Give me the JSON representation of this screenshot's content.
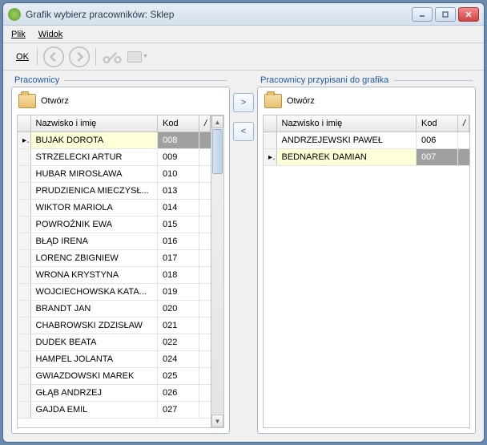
{
  "window": {
    "title": "Grafik wybierz pracowników: Sklep"
  },
  "menu": {
    "file": "Plik",
    "view": "Widok"
  },
  "toolbar": {
    "ok_label": "OK"
  },
  "left_panel": {
    "legend": "Pracownicy",
    "open_label": "Otwórz",
    "columns": {
      "name": "Nazwisko i imię",
      "code": "Kod",
      "mark": "/"
    },
    "rows": [
      {
        "name": "BUJAK DOROTA",
        "code": "008",
        "selected": true
      },
      {
        "name": "STRZELECKI ARTUR",
        "code": "009"
      },
      {
        "name": "HUBAR MIROSŁAWA",
        "code": "010"
      },
      {
        "name": "PRUDZIENICA MIECZYSŁ...",
        "code": "013"
      },
      {
        "name": "WIKTOR MARIOLA",
        "code": "014"
      },
      {
        "name": "POWROŹNIK EWA",
        "code": "015"
      },
      {
        "name": "BŁĄD IRENA",
        "code": "016"
      },
      {
        "name": "LORENC ZBIGNIEW",
        "code": "017"
      },
      {
        "name": "WRONA KRYSTYNA",
        "code": "018"
      },
      {
        "name": "WOJCIECHOWSKA KATA...",
        "code": "019"
      },
      {
        "name": "BRANDT JAN",
        "code": "020"
      },
      {
        "name": "CHABROWSKI ZDZISŁAW",
        "code": "021"
      },
      {
        "name": "DUDEK BEATA",
        "code": "022"
      },
      {
        "name": "HAMPEL JOLANTA",
        "code": "024"
      },
      {
        "name": "GWIAZDOWSKI MAREK",
        "code": "025"
      },
      {
        "name": "GŁĄB ANDRZEJ",
        "code": "026"
      },
      {
        "name": "GAJDA EMIL",
        "code": "027"
      }
    ]
  },
  "right_panel": {
    "legend": "Pracownicy przypisani do grafika",
    "open_label": "Otwórz",
    "columns": {
      "name": "Nazwisko i imię",
      "code": "Kod",
      "mark": "/"
    },
    "rows": [
      {
        "name": "ANDRZEJEWSKI PAWEŁ",
        "code": "006"
      },
      {
        "name": "BEDNAREK DAMIAN",
        "code": "007",
        "selected": true
      }
    ]
  },
  "move_buttons": {
    "right": ">",
    "left": "<"
  }
}
